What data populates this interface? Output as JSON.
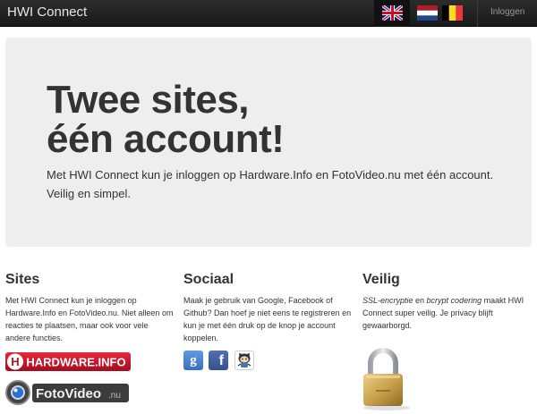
{
  "navbar": {
    "brand": "HWI Connect",
    "languages": [
      "English",
      "Nederlands",
      "België"
    ],
    "login_label": "Inloggen"
  },
  "hero": {
    "title_line1": "Twee sites,",
    "title_line2": "één account!",
    "lead": "Met HWI Connect kun je inloggen op Hardware.Info en FotoVideo.nu met één account. Veilig en simpel."
  },
  "columns": {
    "sites": {
      "title": "Sites",
      "text": "Met HWI Connect kun je inloggen op Hardware.Info en FotoVideo.nu. Niet alleen om reacties te plaatsen, maar ook voor vele andere functies."
    },
    "sociaal": {
      "title": "Sociaal",
      "text": "Maak je gebruik van Google, Facebook of Github? Dan hoef je niet eens te registreren en kun je met één druk op de knop je account koppelen."
    },
    "veilig": {
      "title": "Veilig",
      "text_em1": "SSL-encryptie",
      "text_mid": " en ",
      "text_em2": "bcrypt codering",
      "text_rest": " maakt HWI Connect super veilig. Je privacy blijft gewaarborgd."
    }
  },
  "logos": {
    "hardware_info": "HARDWARE.INFO",
    "fotovideo_main": "FotoVideo",
    "fotovideo_suffix": ".nu"
  },
  "social": {
    "google_glyph": "g",
    "facebook_glyph": "f"
  },
  "colors": {
    "navbar_bg": "#1a1a1a",
    "hero_bg": "#eeeeee",
    "hwi_red": "#c8102e"
  }
}
